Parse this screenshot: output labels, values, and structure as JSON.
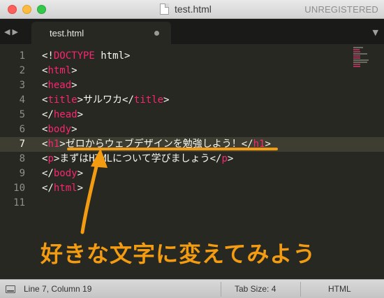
{
  "window": {
    "title": "test.html",
    "registration": "UNREGISTERED"
  },
  "tabs": [
    {
      "label": "test.html",
      "modified": true
    }
  ],
  "editor": {
    "active_line": 7,
    "lines": [
      {
        "n": "1",
        "parts": [
          [
            "p",
            "<!"
          ],
          [
            "t",
            "DOCTYPE"
          ],
          [
            "p",
            " html>"
          ]
        ]
      },
      {
        "n": "2",
        "parts": [
          [
            "p",
            "<"
          ],
          [
            "t",
            "html"
          ],
          [
            "p",
            ">"
          ]
        ]
      },
      {
        "n": "3",
        "parts": [
          [
            "p",
            "<"
          ],
          [
            "t",
            "head"
          ],
          [
            "p",
            ">"
          ]
        ]
      },
      {
        "n": "4",
        "parts": [
          [
            "p",
            "<"
          ],
          [
            "t",
            "title"
          ],
          [
            "p",
            ">サルワカ</"
          ],
          [
            "t",
            "title"
          ],
          [
            "p",
            ">"
          ]
        ]
      },
      {
        "n": "5",
        "parts": [
          [
            "p",
            "</"
          ],
          [
            "t",
            "head"
          ],
          [
            "p",
            ">"
          ]
        ]
      },
      {
        "n": "6",
        "parts": [
          [
            "p",
            "<"
          ],
          [
            "t",
            "body"
          ],
          [
            "p",
            ">"
          ]
        ]
      },
      {
        "n": "7",
        "parts": [
          [
            "p",
            "<"
          ],
          [
            "t",
            "h1"
          ],
          [
            "p",
            ">ゼロからウェブデザインを勉強しよう！</"
          ],
          [
            "t",
            "h1"
          ],
          [
            "p",
            ">"
          ]
        ]
      },
      {
        "n": "8",
        "parts": [
          [
            "p",
            "<"
          ],
          [
            "t",
            "p"
          ],
          [
            "p",
            ">まずはHTMLについて学びましょう</"
          ],
          [
            "t",
            "p"
          ],
          [
            "p",
            ">"
          ]
        ]
      },
      {
        "n": "9",
        "parts": [
          [
            "p",
            "</"
          ],
          [
            "t",
            "body"
          ],
          [
            "p",
            ">"
          ]
        ]
      },
      {
        "n": "10",
        "parts": [
          [
            "p",
            "</"
          ],
          [
            "t",
            "html"
          ],
          [
            "p",
            ">"
          ]
        ]
      },
      {
        "n": "11",
        "parts": []
      }
    ]
  },
  "annotation": {
    "caption": "好きな文字に変えてみよう",
    "color": "#f39c12"
  },
  "status": {
    "position": "Line 7, Column 19",
    "tab_size": "Tab Size: 4",
    "syntax": "HTML"
  },
  "colors": {
    "background": "#272822",
    "tag": "#f92672",
    "text": "#f8f8f2",
    "line_number": "#8f908a"
  }
}
